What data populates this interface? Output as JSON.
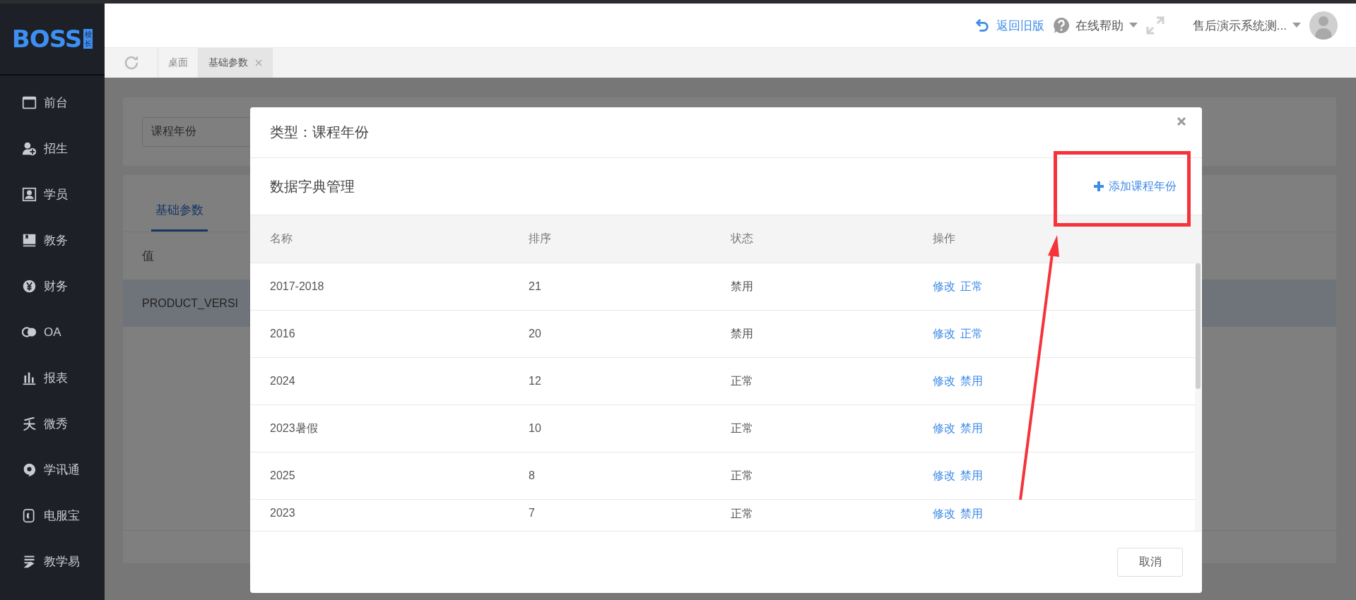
{
  "logo": {
    "text": "BOSS",
    "badge": "校长"
  },
  "sidebar": {
    "items": [
      {
        "label": "前台",
        "selected": false
      },
      {
        "label": "招生",
        "selected": false
      },
      {
        "label": "学员",
        "selected": false
      },
      {
        "label": "教务",
        "selected": false
      },
      {
        "label": "财务",
        "selected": false
      },
      {
        "label": "OA",
        "selected": false
      },
      {
        "label": "报表",
        "selected": false
      },
      {
        "label": "微秀",
        "selected": false
      },
      {
        "label": "学讯通",
        "selected": false
      },
      {
        "label": "电服宝",
        "selected": false
      },
      {
        "label": "教学易",
        "selected": false
      }
    ]
  },
  "header": {
    "back_link": "返回旧版",
    "help": "在线帮助",
    "user": "售后演示系统测..."
  },
  "tabs": [
    {
      "label": "桌面",
      "selected": false,
      "closable": false
    },
    {
      "label": "基础参数",
      "selected": true,
      "closable": true
    }
  ],
  "background_page": {
    "type_select": "课程年份",
    "tabs": [
      {
        "label": "基础参数",
        "selected": true
      }
    ],
    "table": {
      "columns": [
        "值"
      ],
      "rows": [
        {
          "cells": [
            "PRODUCT_VERSI"
          ],
          "selected": true
        }
      ]
    }
  },
  "dialog": {
    "title": "类型：课程年份",
    "section_title": "数据字典管理",
    "add_link": "添加课程年份",
    "table": {
      "columns": [
        "名称",
        "排序",
        "状态",
        "操作"
      ],
      "rows": [
        {
          "name": "2017-2018",
          "order": "21",
          "status": "禁用",
          "actions": [
            "修改",
            "正常"
          ]
        },
        {
          "name": "2016",
          "order": "20",
          "status": "禁用",
          "actions": [
            "修改",
            "正常"
          ]
        },
        {
          "name": "2024",
          "order": "12",
          "status": "正常",
          "actions": [
            "修改",
            "禁用"
          ]
        },
        {
          "name": "2023暑假",
          "order": "10",
          "status": "正常",
          "actions": [
            "修改",
            "禁用"
          ]
        },
        {
          "name": "2025",
          "order": "8",
          "status": "正常",
          "actions": [
            "修改",
            "禁用"
          ]
        },
        {
          "name": "2023",
          "order": "7",
          "status": "正常",
          "actions": [
            "修改",
            "禁用"
          ]
        }
      ]
    },
    "buttons": [
      {
        "label": "取消"
      }
    ]
  }
}
